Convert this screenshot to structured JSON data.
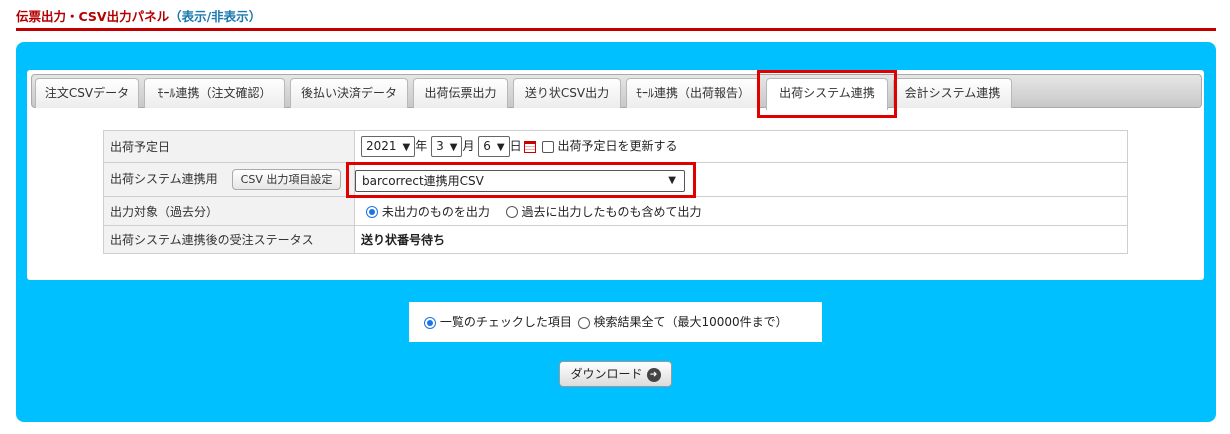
{
  "panel": {
    "title": "伝票出力・CSV出力パネル",
    "toggle_open": "（",
    "toggle_label": "表示/非表示",
    "toggle_close": "）"
  },
  "tabs": [
    {
      "label": "注文CSVデータ",
      "active": false
    },
    {
      "label": "ﾓｰﾙ連携（注文確認）",
      "active": false
    },
    {
      "label": "後払い決済データ",
      "active": false
    },
    {
      "label": "出荷伝票出力",
      "active": false
    },
    {
      "label": "送り状CSV出力",
      "active": false
    },
    {
      "label": "ﾓｰﾙ連携（出荷報告）",
      "active": false
    },
    {
      "label": "出荷システム連携",
      "active": true
    },
    {
      "label": "会計システム連携",
      "active": false
    }
  ],
  "form": {
    "ship_date": {
      "label": "出荷予定日",
      "year": "2021",
      "year_unit": "年",
      "month": "3",
      "month_unit": "月",
      "day": "6",
      "day_unit": "日",
      "update_checkbox_label": "出荷予定日を更新する",
      "update_checked": false
    },
    "system": {
      "label": "出荷システム連携用",
      "settings_button": "CSV 出力項目設定",
      "selected_csv": "barcorrect連携用CSV"
    },
    "target": {
      "label": "出力対象（過去分）",
      "options": [
        {
          "label": "未出力のものを出力",
          "checked": true
        },
        {
          "label": "過去に出力したものも含めて出力",
          "checked": false
        }
      ]
    },
    "status_after": {
      "label": "出荷システム連携後の受注ステータス",
      "value": "送り状番号待ち"
    }
  },
  "scope": {
    "options": [
      {
        "label": "一覧のチェックした項目",
        "checked": true
      },
      {
        "label": "検索結果全て（最大10000件まで）",
        "checked": false
      }
    ]
  },
  "download": {
    "label": "ダウンロード"
  },
  "colors": {
    "accent_bg": "#00c0ff",
    "title_red": "#b40000",
    "highlight": "#e00000",
    "link": "#1a7ab0"
  }
}
